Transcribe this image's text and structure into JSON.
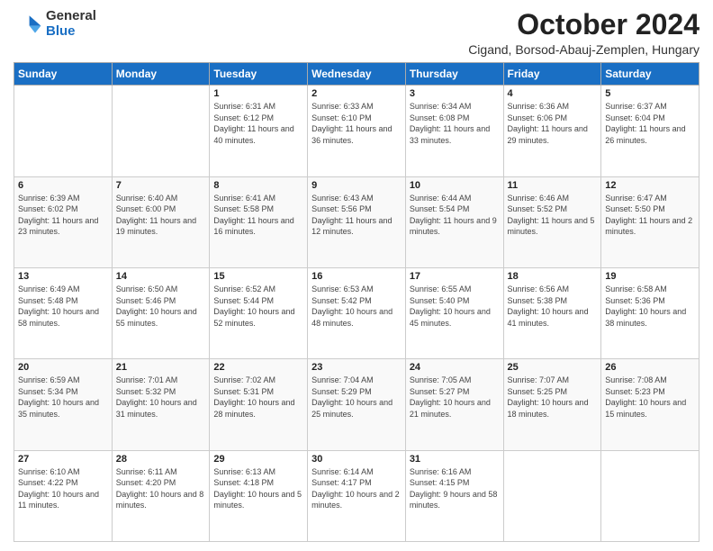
{
  "logo": {
    "general": "General",
    "blue": "Blue"
  },
  "header": {
    "month": "October 2024",
    "location": "Cigand, Borsod-Abauj-Zemplen, Hungary"
  },
  "weekdays": [
    "Sunday",
    "Monday",
    "Tuesday",
    "Wednesday",
    "Thursday",
    "Friday",
    "Saturday"
  ],
  "weeks": [
    [
      {
        "day": "",
        "info": ""
      },
      {
        "day": "",
        "info": ""
      },
      {
        "day": "1",
        "info": "Sunrise: 6:31 AM\nSunset: 6:12 PM\nDaylight: 11 hours and 40 minutes."
      },
      {
        "day": "2",
        "info": "Sunrise: 6:33 AM\nSunset: 6:10 PM\nDaylight: 11 hours and 36 minutes."
      },
      {
        "day": "3",
        "info": "Sunrise: 6:34 AM\nSunset: 6:08 PM\nDaylight: 11 hours and 33 minutes."
      },
      {
        "day": "4",
        "info": "Sunrise: 6:36 AM\nSunset: 6:06 PM\nDaylight: 11 hours and 29 minutes."
      },
      {
        "day": "5",
        "info": "Sunrise: 6:37 AM\nSunset: 6:04 PM\nDaylight: 11 hours and 26 minutes."
      }
    ],
    [
      {
        "day": "6",
        "info": "Sunrise: 6:39 AM\nSunset: 6:02 PM\nDaylight: 11 hours and 23 minutes."
      },
      {
        "day": "7",
        "info": "Sunrise: 6:40 AM\nSunset: 6:00 PM\nDaylight: 11 hours and 19 minutes."
      },
      {
        "day": "8",
        "info": "Sunrise: 6:41 AM\nSunset: 5:58 PM\nDaylight: 11 hours and 16 minutes."
      },
      {
        "day": "9",
        "info": "Sunrise: 6:43 AM\nSunset: 5:56 PM\nDaylight: 11 hours and 12 minutes."
      },
      {
        "day": "10",
        "info": "Sunrise: 6:44 AM\nSunset: 5:54 PM\nDaylight: 11 hours and 9 minutes."
      },
      {
        "day": "11",
        "info": "Sunrise: 6:46 AM\nSunset: 5:52 PM\nDaylight: 11 hours and 5 minutes."
      },
      {
        "day": "12",
        "info": "Sunrise: 6:47 AM\nSunset: 5:50 PM\nDaylight: 11 hours and 2 minutes."
      }
    ],
    [
      {
        "day": "13",
        "info": "Sunrise: 6:49 AM\nSunset: 5:48 PM\nDaylight: 10 hours and 58 minutes."
      },
      {
        "day": "14",
        "info": "Sunrise: 6:50 AM\nSunset: 5:46 PM\nDaylight: 10 hours and 55 minutes."
      },
      {
        "day": "15",
        "info": "Sunrise: 6:52 AM\nSunset: 5:44 PM\nDaylight: 10 hours and 52 minutes."
      },
      {
        "day": "16",
        "info": "Sunrise: 6:53 AM\nSunset: 5:42 PM\nDaylight: 10 hours and 48 minutes."
      },
      {
        "day": "17",
        "info": "Sunrise: 6:55 AM\nSunset: 5:40 PM\nDaylight: 10 hours and 45 minutes."
      },
      {
        "day": "18",
        "info": "Sunrise: 6:56 AM\nSunset: 5:38 PM\nDaylight: 10 hours and 41 minutes."
      },
      {
        "day": "19",
        "info": "Sunrise: 6:58 AM\nSunset: 5:36 PM\nDaylight: 10 hours and 38 minutes."
      }
    ],
    [
      {
        "day": "20",
        "info": "Sunrise: 6:59 AM\nSunset: 5:34 PM\nDaylight: 10 hours and 35 minutes."
      },
      {
        "day": "21",
        "info": "Sunrise: 7:01 AM\nSunset: 5:32 PM\nDaylight: 10 hours and 31 minutes."
      },
      {
        "day": "22",
        "info": "Sunrise: 7:02 AM\nSunset: 5:31 PM\nDaylight: 10 hours and 28 minutes."
      },
      {
        "day": "23",
        "info": "Sunrise: 7:04 AM\nSunset: 5:29 PM\nDaylight: 10 hours and 25 minutes."
      },
      {
        "day": "24",
        "info": "Sunrise: 7:05 AM\nSunset: 5:27 PM\nDaylight: 10 hours and 21 minutes."
      },
      {
        "day": "25",
        "info": "Sunrise: 7:07 AM\nSunset: 5:25 PM\nDaylight: 10 hours and 18 minutes."
      },
      {
        "day": "26",
        "info": "Sunrise: 7:08 AM\nSunset: 5:23 PM\nDaylight: 10 hours and 15 minutes."
      }
    ],
    [
      {
        "day": "27",
        "info": "Sunrise: 6:10 AM\nSunset: 4:22 PM\nDaylight: 10 hours and 11 minutes."
      },
      {
        "day": "28",
        "info": "Sunrise: 6:11 AM\nSunset: 4:20 PM\nDaylight: 10 hours and 8 minutes."
      },
      {
        "day": "29",
        "info": "Sunrise: 6:13 AM\nSunset: 4:18 PM\nDaylight: 10 hours and 5 minutes."
      },
      {
        "day": "30",
        "info": "Sunrise: 6:14 AM\nSunset: 4:17 PM\nDaylight: 10 hours and 2 minutes."
      },
      {
        "day": "31",
        "info": "Sunrise: 6:16 AM\nSunset: 4:15 PM\nDaylight: 9 hours and 58 minutes."
      },
      {
        "day": "",
        "info": ""
      },
      {
        "day": "",
        "info": ""
      }
    ]
  ]
}
